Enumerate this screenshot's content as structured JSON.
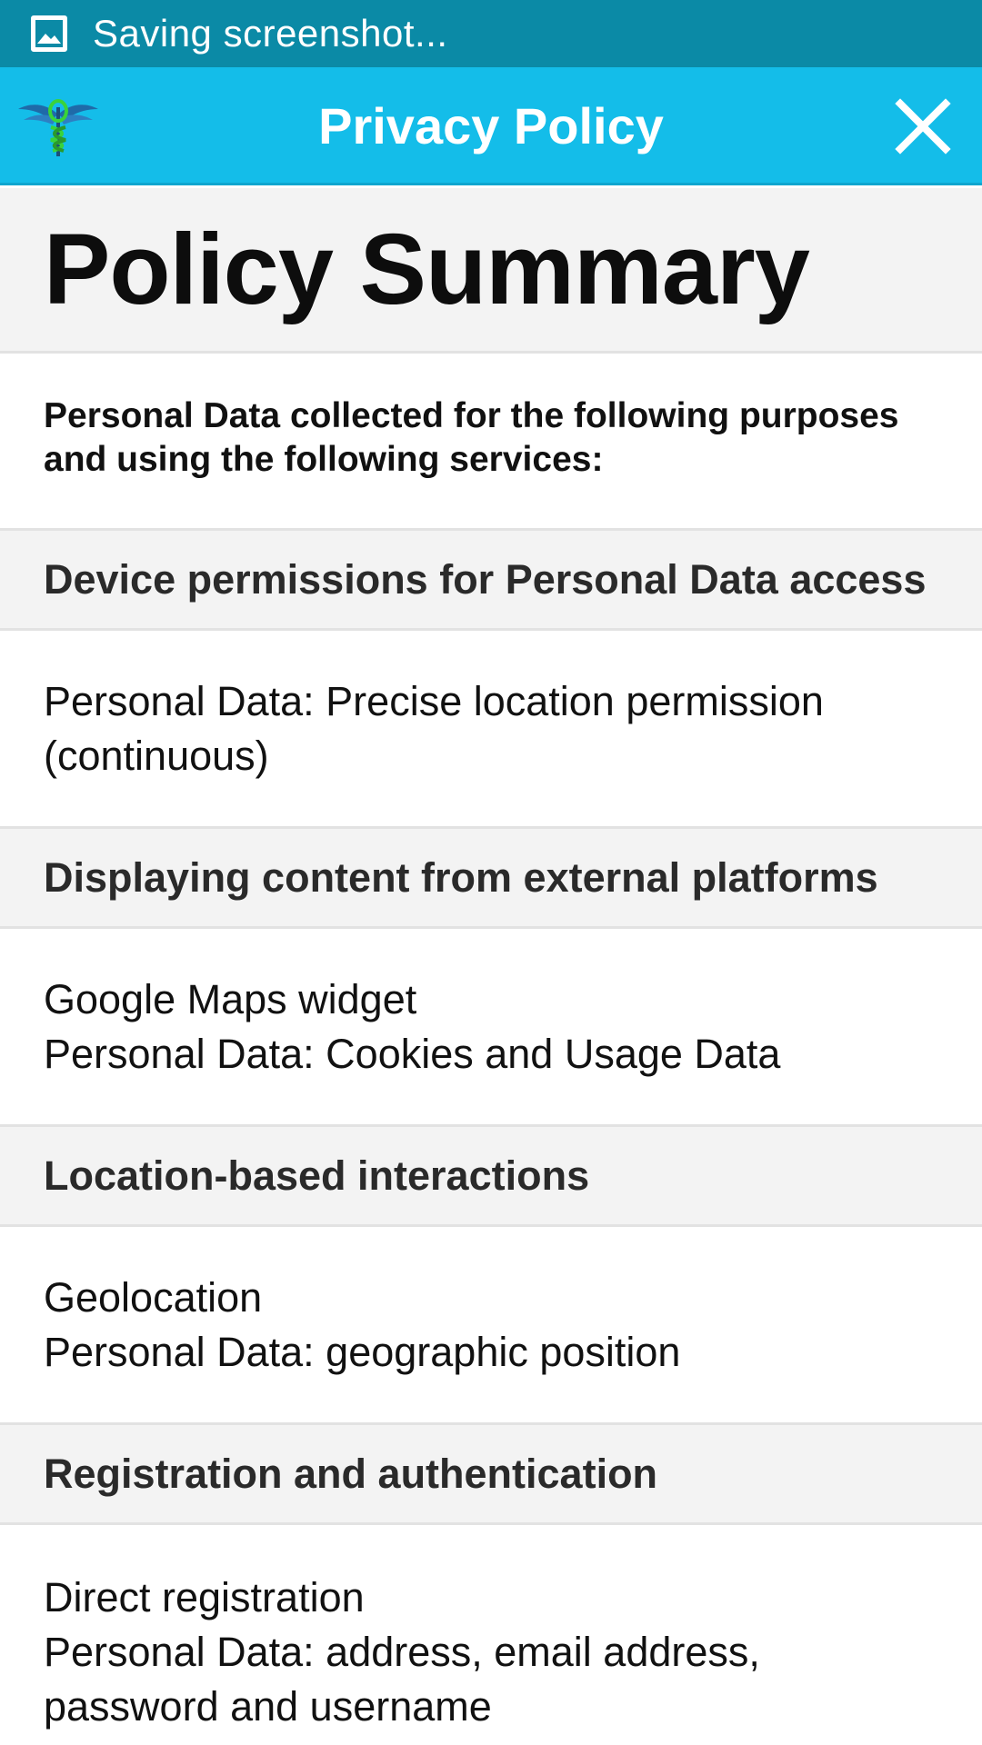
{
  "status_bar": {
    "icon": "image-icon",
    "text": "Saving screenshot..."
  },
  "app_bar": {
    "logo": "caduceus-logo",
    "title": "Privacy Policy",
    "close_icon": "close-icon",
    "colors": {
      "status": "#0b8aa6",
      "bar": "#14bde9"
    }
  },
  "page": {
    "title": "Policy Summary",
    "intro": "Personal Data collected for the following purposes and using the following services:",
    "sections": [
      {
        "heading": "Device permissions for Personal Data access",
        "lines": [
          "Personal Data: Precise location permission (continuous)"
        ]
      },
      {
        "heading": "Displaying content from external platforms",
        "lines": [
          "Google Maps widget",
          "Personal Data: Cookies and Usage Data"
        ]
      },
      {
        "heading": "Location-based interactions",
        "lines": [
          "Geolocation",
          "Personal Data: geographic position"
        ]
      },
      {
        "heading": "Registration and authentication",
        "lines": [
          "Direct registration",
          "Personal Data: address, email address, password and username"
        ]
      }
    ]
  }
}
